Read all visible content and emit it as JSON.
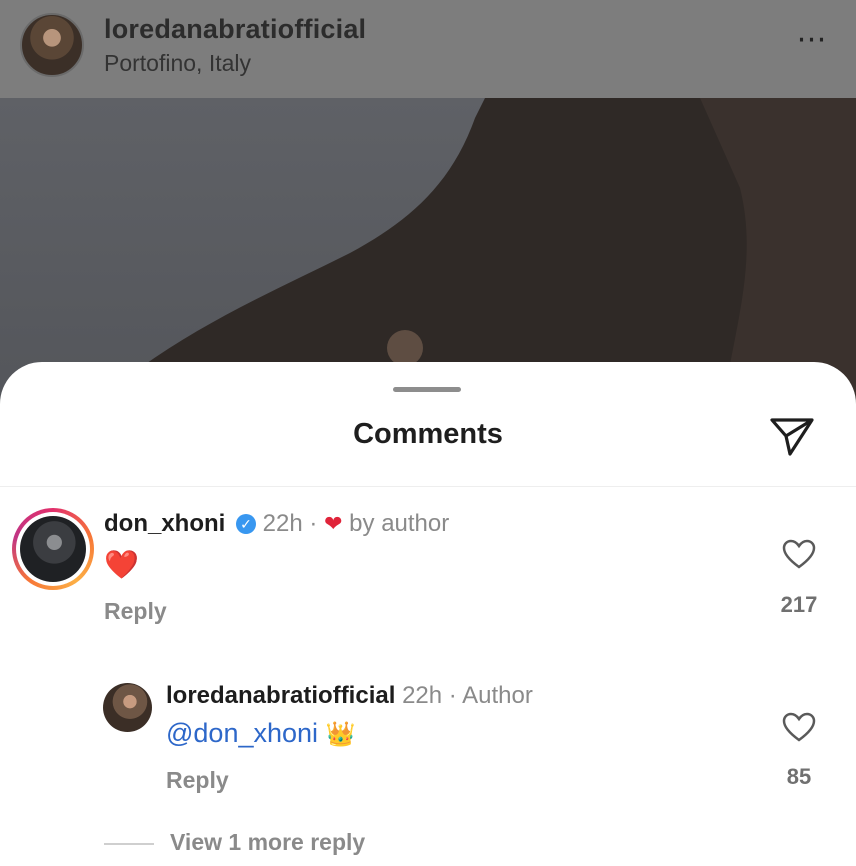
{
  "post": {
    "username": "loredanabratiofficial",
    "location": "Portofino, Italy",
    "more_icon": "more-horizontal-icon"
  },
  "sheet": {
    "title": "Comments",
    "share_icon": "send-icon"
  },
  "comments": [
    {
      "username": "don_xhoni",
      "verified": true,
      "time": "22h",
      "separator": "·",
      "liked_by_author_icon": "heart-filled-icon",
      "liked_by_author_text": "by author",
      "body_emoji": "❤️",
      "reply_label": "Reply",
      "like_count": "217",
      "like_icon": "heart-outline-icon"
    }
  ],
  "reply": {
    "username": "loredanabratiofficial",
    "time": "22h",
    "separator": "·",
    "author_tag": "Author",
    "mention": "@don_xhoni",
    "emoji": "👑",
    "reply_label": "Reply",
    "like_count": "85",
    "like_icon": "heart-outline-icon"
  },
  "view_more": "View 1 more reply",
  "colors": {
    "link_blue": "#2d67c9",
    "heart_red": "#e0243a",
    "verified_blue": "#3897f0",
    "muted_gray": "#8a8a8a"
  }
}
